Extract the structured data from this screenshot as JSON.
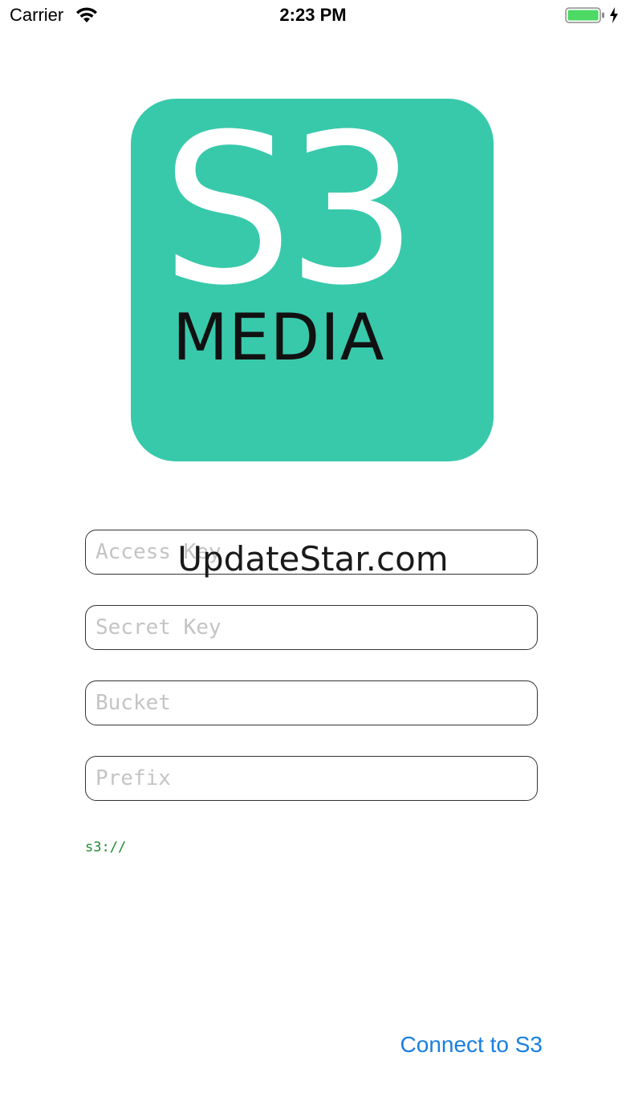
{
  "status_bar": {
    "carrier": "Carrier",
    "time": "2:23 PM",
    "battery_color": "#4cd964"
  },
  "logo": {
    "title": "S3",
    "subtitle": "MEDIA",
    "background_color": "#38c9ab"
  },
  "form": {
    "access_key_placeholder": "Access Key",
    "secret_key_placeholder": "Secret Key",
    "bucket_placeholder": "Bucket",
    "prefix_placeholder": "Prefix",
    "path_preview": "s3://"
  },
  "watermark": "UpdateStar.com",
  "actions": {
    "connect_label": "Connect to S3",
    "accent_color": "#1a7fe0"
  }
}
